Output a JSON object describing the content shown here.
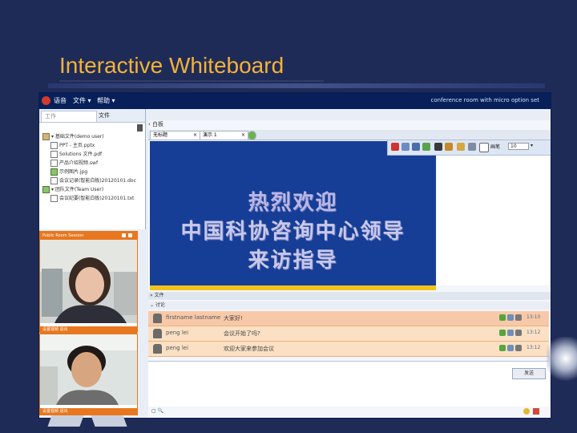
{
  "slide": {
    "title": "Interactive Whiteboard"
  },
  "colors": {
    "background": "#1f2b57",
    "title": "#f3b23a",
    "menubar": "#07205a",
    "board": "#163e96",
    "video_frame": "#e8771f"
  },
  "menubar": {
    "items": [
      "语音",
      "文件 ▾",
      "帮助 ▾"
    ],
    "room_label": "conference room with micro option set"
  },
  "left_panel": {
    "tabs": [
      "工作",
      "文件"
    ],
    "tree": [
      "▾ 基础文件(demo user)",
      "PPT - 主页.pptx",
      "Solutions 文件.pdf",
      "产品介绍视频.swf",
      "示例图片.jpg",
      "会议记录(智能白板)20120101.doc",
      "▾ 团队文件(Team User)",
      "会议纪要(智能白板)20120101.txt"
    ],
    "trash_icon": "trash-icon"
  },
  "videos": [
    {
      "header": "Public Room Session",
      "footer": "设置视频  退出"
    },
    {
      "header": "",
      "footer": "设置视频  退出"
    }
  ],
  "center": {
    "breadcrumb": "‹ 白板",
    "doc_tabs": [
      "无标题",
      "演示 1"
    ],
    "whiteboard_lines": [
      "热烈欢迎",
      "中国科协咨询中心领导",
      "来访指导"
    ],
    "toolbar": {
      "size_label": "画笔",
      "size_value": "10"
    },
    "splitter_label": "» 文件",
    "chat_label": "⌄ 讨论"
  },
  "chat": {
    "rows": [
      {
        "name": "firstname lastname",
        "message": "大家好!",
        "time": "13:10"
      },
      {
        "name": "peng lei",
        "message": "会议开始了吗?",
        "time": "13:12"
      },
      {
        "name": "peng lei",
        "message": "欢迎大家来参加会议",
        "time": "13:12"
      }
    ],
    "send_label": "发送"
  },
  "statusbar": {
    "text": "▢ 🔍"
  }
}
